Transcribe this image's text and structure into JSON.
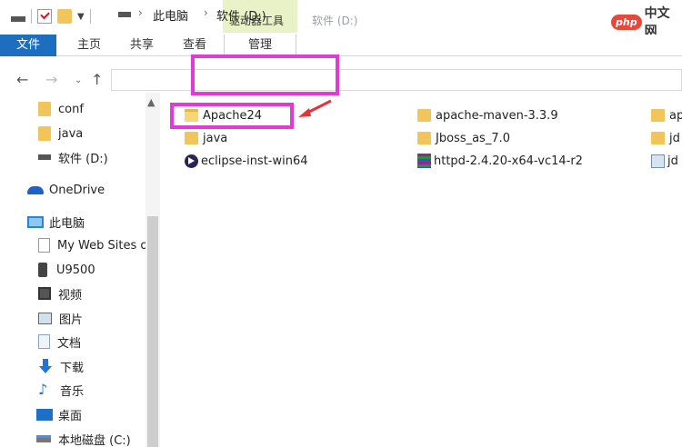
{
  "titlebar": {
    "context_tab_label": "驱动器工具",
    "window_title": "软件 (D:)",
    "watermark_logo": "php",
    "watermark_text": "中文网"
  },
  "ribbon": {
    "tabs": [
      {
        "label": "文件"
      },
      {
        "label": "主页"
      },
      {
        "label": "共享"
      },
      {
        "label": "查看"
      },
      {
        "label": "管理"
      }
    ]
  },
  "address": {
    "crumbs": [
      "此电脑",
      "软件 (D:)"
    ]
  },
  "sidebar": {
    "items": [
      {
        "label": "conf",
        "icon": "folder-icon"
      },
      {
        "label": "java",
        "icon": "folder-icon"
      },
      {
        "label": "软件 (D:)",
        "icon": "drive-icon"
      },
      {
        "label": "OneDrive",
        "icon": "cloud-icon"
      },
      {
        "label": "此电脑",
        "icon": "computer-icon"
      },
      {
        "label": "My Web Sites o",
        "icon": "page-icon"
      },
      {
        "label": "U9500",
        "icon": "phone-icon"
      },
      {
        "label": "视频",
        "icon": "video-icon"
      },
      {
        "label": "图片",
        "icon": "picture-icon"
      },
      {
        "label": "文档",
        "icon": "document-icon"
      },
      {
        "label": "下载",
        "icon": "download-icon"
      },
      {
        "label": "音乐",
        "icon": "music-icon"
      },
      {
        "label": "桌面",
        "icon": "desktop-icon"
      },
      {
        "label": "本地磁盘 (C:)",
        "icon": "local-disk-icon"
      }
    ]
  },
  "files": [
    {
      "name": "Apache24",
      "icon": "folder-open-icon"
    },
    {
      "name": "java",
      "icon": "folder-icon"
    },
    {
      "name": "eclipse-inst-win64",
      "icon": "eclipse-icon"
    },
    {
      "name": "apache-maven-3.3.9",
      "icon": "folder-icon"
    },
    {
      "name": "Jboss_as_7.0",
      "icon": "folder-icon"
    },
    {
      "name": "httpd-2.4.20-x64-vc14-r2",
      "icon": "archive-icon"
    },
    {
      "name": "ap",
      "icon": "folder-icon"
    },
    {
      "name": "jd",
      "icon": "folder-icon"
    },
    {
      "name": "jd",
      "icon": "image-file-icon"
    }
  ],
  "annotation": {
    "color": "#e23ad8",
    "arrow_color": "#e4343a"
  }
}
